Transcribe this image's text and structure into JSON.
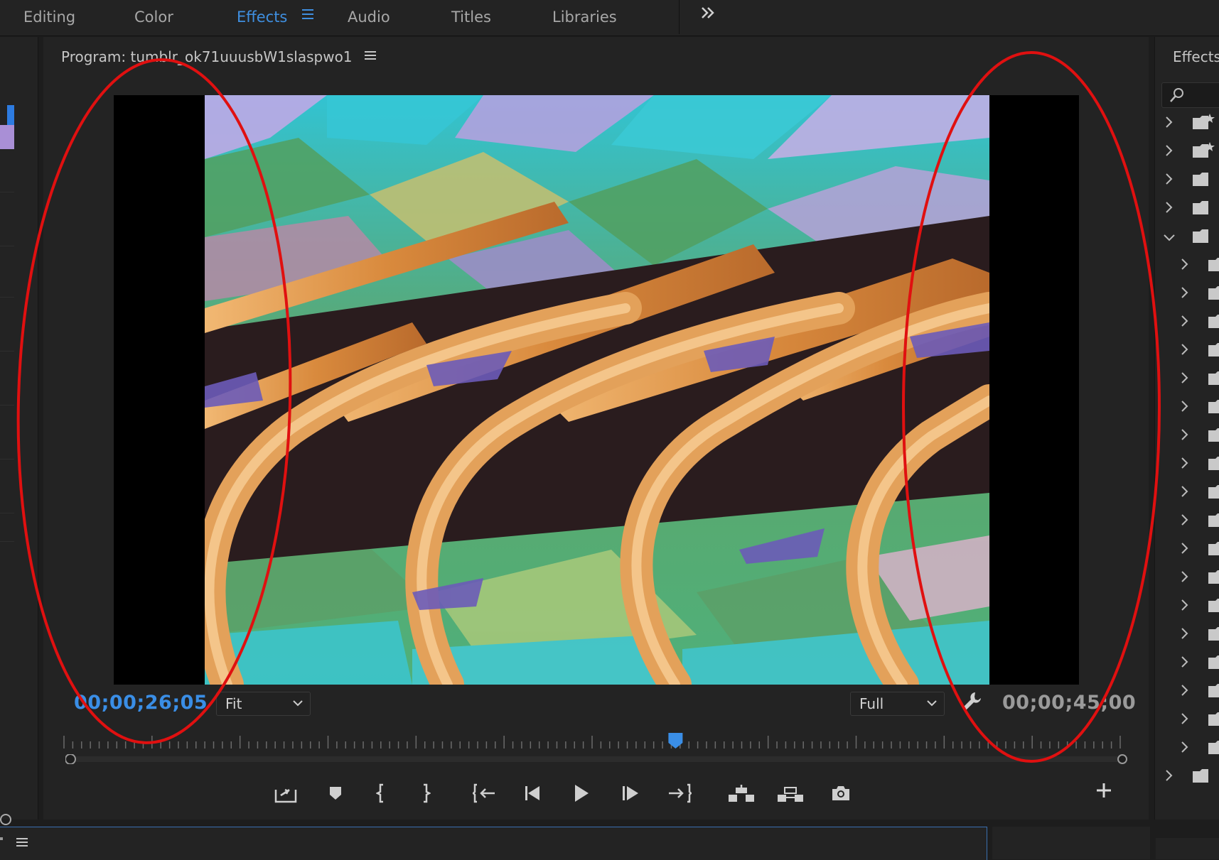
{
  "workspace_tabs": [
    {
      "label": "Editing",
      "active": false
    },
    {
      "label": "Color",
      "active": false
    },
    {
      "label": "Effects",
      "active": true
    },
    {
      "label": "Audio",
      "active": false
    },
    {
      "label": "Titles",
      "active": false
    },
    {
      "label": "Libraries",
      "active": false
    }
  ],
  "program": {
    "title": "Program: tumblr_ok71uuusbW1slaspwo1",
    "timecode_current": "00;00;26;05",
    "timecode_duration": "00;00;45;00",
    "zoom": "Fit",
    "resolution": "Full",
    "playhead_fraction": 0.579
  },
  "effects_panel": {
    "title": "Effects"
  },
  "colors": {
    "accent": "#3f8fe0",
    "timecode": "#3a8ee6",
    "annotation": "#e01010",
    "panel": "#232323"
  },
  "transport_icons": [
    "export-frame-icon",
    "add-marker-icon",
    "mark-in-icon",
    "mark-out-icon",
    "go-to-in-icon",
    "step-back-icon",
    "play-icon",
    "step-forward-icon",
    "go-to-out-icon",
    "lift-icon",
    "extract-icon",
    "camera-icon"
  ]
}
